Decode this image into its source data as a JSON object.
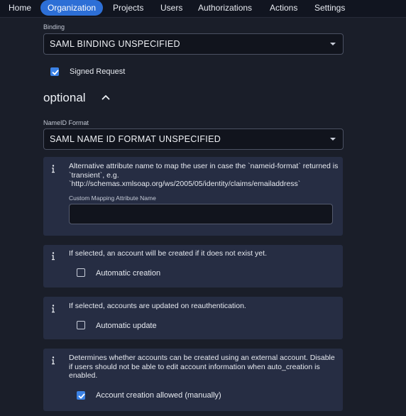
{
  "nav": {
    "items": [
      "Home",
      "Organization",
      "Projects",
      "Users",
      "Authorizations",
      "Actions",
      "Settings"
    ],
    "active_index": 1
  },
  "binding": {
    "label": "Binding",
    "value": "SAML BINDING UNSPECIFIED"
  },
  "signed_request": {
    "label": "Signed Request",
    "checked": true
  },
  "optional": {
    "title": "optional",
    "expanded": true
  },
  "nameid": {
    "label": "NameID Format",
    "value": "SAML NAME ID FORMAT UNSPECIFIED"
  },
  "mapping_card": {
    "info": "Alternative attribute name to map the user in case the `nameid-format` returned is `transient`, e.g. `http://schemas.xmlsoap.org/ws/2005/05/identity/claims/emailaddress`",
    "field_label": "Custom Mapping Attribute Name",
    "field_value": ""
  },
  "auto_creation_card": {
    "info": "If selected, an account will be created if it does not exist yet.",
    "checkbox_label": "Automatic creation",
    "checked": false
  },
  "auto_update_card": {
    "info": "If selected, accounts are updated on reauthentication.",
    "checkbox_label": "Automatic update",
    "checked": false
  },
  "account_creation_card": {
    "info": "Determines whether accounts can be created using an external account. Disable if users should not be able to edit account information when auto_creation is enabled.",
    "checkbox_label": "Account creation allowed (manually)",
    "checked": true
  },
  "colors": {
    "background": "#1a1e29",
    "nav_background": "#111520",
    "accent": "#2d6fd6",
    "card": "#262d43"
  }
}
